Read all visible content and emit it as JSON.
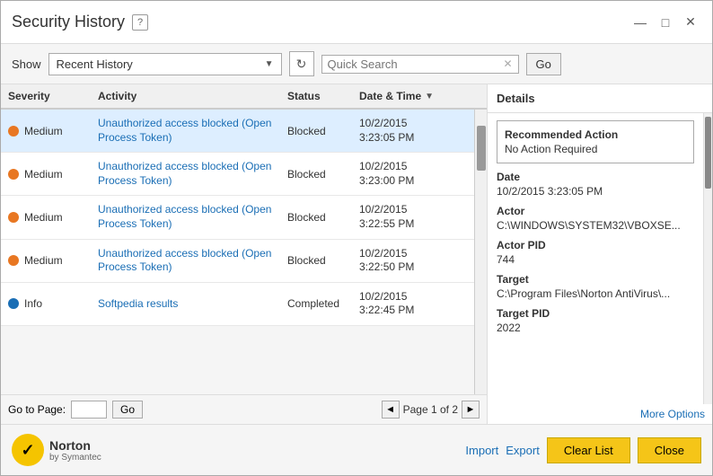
{
  "window": {
    "title": "Security History",
    "help_label": "?",
    "controls": {
      "minimize": "—",
      "maximize": "□",
      "close": "✕"
    }
  },
  "toolbar": {
    "show_label": "Show",
    "dropdown_value": "Recent History",
    "refresh_icon": "↻",
    "search_placeholder": "Quick Search",
    "go_label": "Go"
  },
  "table": {
    "headers": [
      {
        "label": "Severity",
        "sortable": false
      },
      {
        "label": "Activity",
        "sortable": false
      },
      {
        "label": "Status",
        "sortable": false
      },
      {
        "label": "Date & Time",
        "sortable": true
      }
    ],
    "rows": [
      {
        "severity": "Medium",
        "severity_color": "orange",
        "activity": "Unauthorized access blocked (Open Process Token)",
        "status": "Blocked",
        "date": "10/2/2015",
        "time": "3:23:05 PM"
      },
      {
        "severity": "Medium",
        "severity_color": "orange",
        "activity": "Unauthorized access blocked (Open Process Token)",
        "status": "Blocked",
        "date": "10/2/2015",
        "time": "3:23:00 PM"
      },
      {
        "severity": "Medium",
        "severity_color": "orange",
        "activity": "Unauthorized access blocked (Open Process Token)",
        "status": "Blocked",
        "date": "10/2/2015",
        "time": "3:22:55 PM"
      },
      {
        "severity": "Medium",
        "severity_color": "orange",
        "activity": "Unauthorized access blocked (Open Process Token)",
        "status": "Blocked",
        "date": "10/2/2015",
        "time": "3:22:50 PM"
      },
      {
        "severity": "Info",
        "severity_color": "blue",
        "activity": "Softpedia results",
        "status": "Completed",
        "date": "10/2/2015",
        "time": "3:22:45 PM"
      }
    ]
  },
  "pagination": {
    "goto_label": "Go to Page:",
    "go_label": "Go",
    "prev": "◄",
    "next": "►",
    "page_info": "Page 1 of 2"
  },
  "details": {
    "header": "Details",
    "recommended_action_label": "Recommended Action",
    "recommended_action_value": "No Action Required",
    "date_label": "Date",
    "date_value": "10/2/2015 3:23:05 PM",
    "actor_label": "Actor",
    "actor_value": "C:\\WINDOWS\\SYSTEM32\\VBOXSE...",
    "actor_pid_label": "Actor PID",
    "actor_pid_value": "744",
    "target_label": "Target",
    "target_value": "C:\\Program Files\\Norton AntiVirus\\...",
    "target_pid_label": "Target PID",
    "target_pid_value": "2022",
    "more_options": "More Options"
  },
  "bottom": {
    "norton_main": "Norton",
    "norton_sub": "by Symantec",
    "import_label": "Import",
    "export_label": "Export",
    "clear_label": "Clear List",
    "close_label": "Close"
  }
}
